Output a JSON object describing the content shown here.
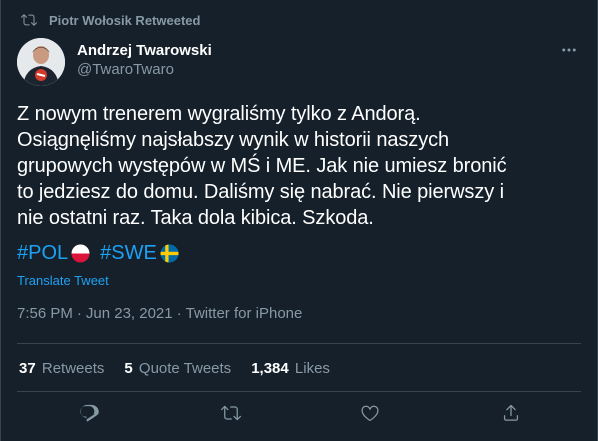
{
  "retweet_bar": {
    "text": "Piotr Wołosik Retweeted",
    "icon": "retweet-icon"
  },
  "author": {
    "name": "Andrzej Twarowski",
    "handle": "@TwaroTwaro"
  },
  "tweet": {
    "lines": [
      "Z nowym trenerem wygraliśmy tylko z Andorą.",
      "Osiągnęliśmy najsłabszy wynik w historii naszych",
      "grupowych występów w MŚ i ME. Jak nie umiesz bronić",
      "to jedziesz do domu. Daliśmy się nabrać. Nie pierwszy i",
      "nie ostatni raz. Taka dola kibica. Szkoda."
    ],
    "hashtags": [
      {
        "text": "#POL",
        "flag": "poland-flag-icon"
      },
      {
        "text": "#SWE",
        "flag": "sweden-flag-icon"
      }
    ],
    "translate_label": "Translate Tweet",
    "time": "7:56 PM",
    "separator": "·",
    "date": "Jun 23, 2021",
    "source": "Twitter for iPhone"
  },
  "stats": {
    "retweets_count": "37",
    "retweets_label": "Retweets",
    "quotes_count": "5",
    "quotes_label": "Quote Tweets",
    "likes_count": "1,384",
    "likes_label": "Likes"
  },
  "actions": [
    "reply-icon",
    "retweet-icon",
    "like-icon",
    "share-icon"
  ],
  "colors": {
    "background": "#15202b",
    "accent": "#1da1f2",
    "muted": "#8899a6",
    "border": "#38444d"
  }
}
